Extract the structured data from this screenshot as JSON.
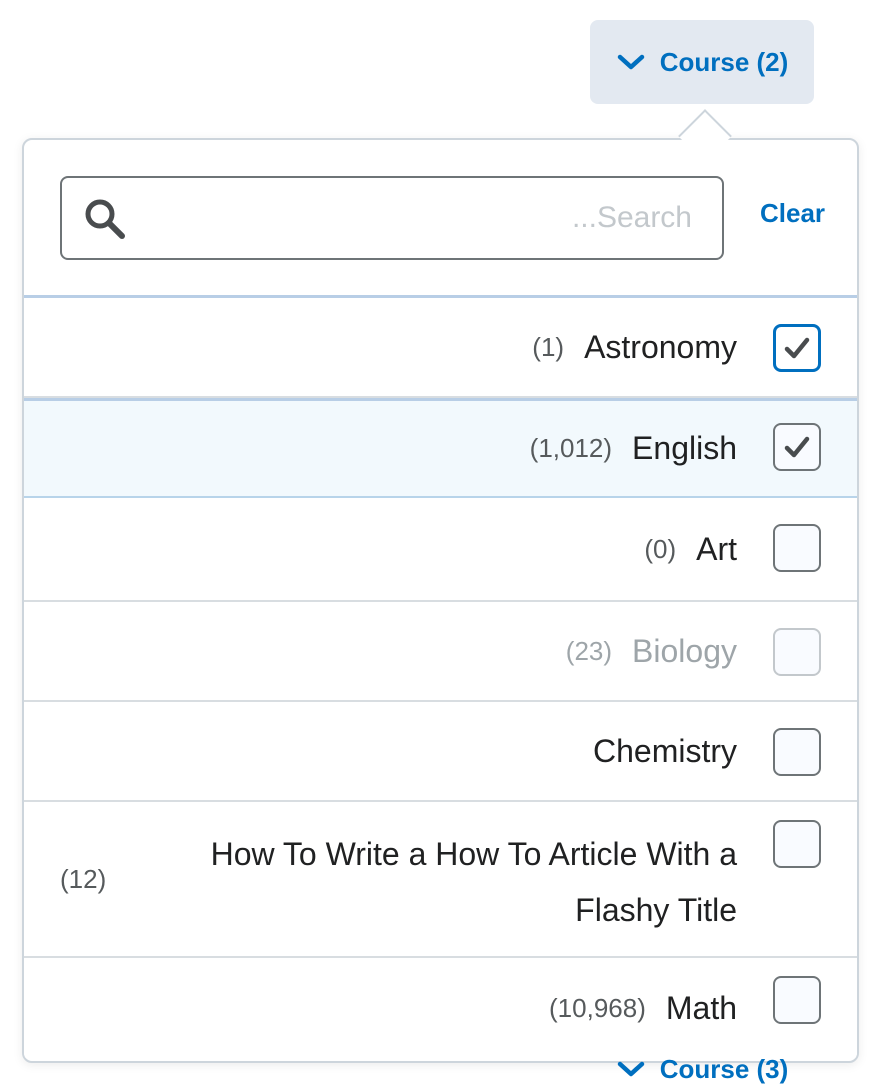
{
  "trigger": {
    "label": "Course (2)"
  },
  "trigger_below": {
    "label": "Course (3)"
  },
  "search": {
    "placeholder": "...Search",
    "value": ""
  },
  "clear_label": "Clear",
  "options": [
    {
      "count": "(1)",
      "label": "Astronomy",
      "checked": true,
      "focused": true,
      "disabled": false
    },
    {
      "count": "(1,012)",
      "label": "English",
      "checked": true,
      "highlighted": true,
      "disabled": false
    },
    {
      "count": "(0)",
      "label": "Art",
      "checked": false,
      "disabled": false
    },
    {
      "count": "(23)",
      "label": "Biology",
      "checked": false,
      "disabled": true
    },
    {
      "count": "",
      "label": "Chemistry",
      "checked": false,
      "disabled": false
    },
    {
      "count": "(12)",
      "label": "How To Write a How To Article With a Flashy Title",
      "checked": false,
      "disabled": false
    },
    {
      "count": "(10,968)",
      "label": "Math",
      "checked": false,
      "disabled": false
    }
  ],
  "colors": {
    "accent": "#006fbf",
    "trigger_bg": "#e3e9f1",
    "highlight_bg": "#f2f9fd"
  }
}
